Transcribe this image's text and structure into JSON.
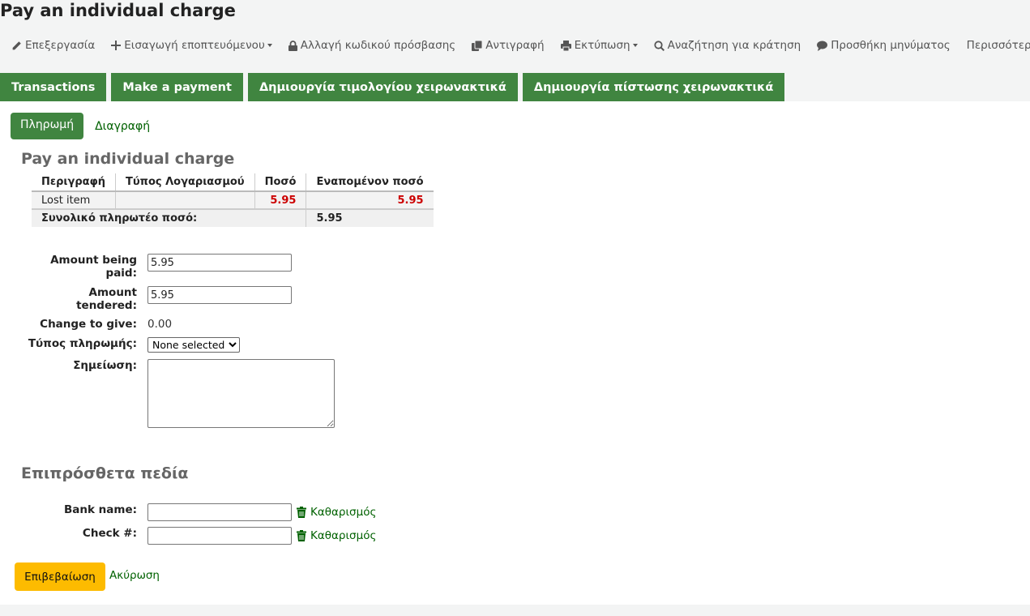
{
  "page_title": "Pay an individual charge",
  "toolbar": {
    "edit": "Επεξεργασία",
    "add_guarantee": "Εισαγωγή εποπτευόμενου",
    "change_password": "Αλλαγή κωδικού πρόσβασης",
    "duplicate": "Αντιγραφή",
    "print": "Εκτύπωση",
    "search_hold": "Αναζήτηση για κράτηση",
    "add_message": "Προσθήκη μηνύματος",
    "more": "Περισσότερα"
  },
  "tabs": [
    "Transactions",
    "Make a payment",
    "Δημιουργία τιμολογίου χειρωνακτικά",
    "Δημιουργία πίστωσης χειρωνακτικά"
  ],
  "subtabs": {
    "pay": "Πληρωμή",
    "delete": "Διαγραφή"
  },
  "section_title": "Pay an individual charge",
  "table": {
    "headers": [
      "Περιγραφή",
      "Τύπος Λογαριασμού",
      "Ποσό",
      "Εναπομένον ποσό"
    ],
    "row": {
      "description": "Lost item",
      "account_type": "",
      "amount": "5.95",
      "outstanding": "5.95"
    },
    "total_label": "Συνολικό πληρωτέο ποσό:",
    "total_value": "5.95"
  },
  "form": {
    "amount_paid_label": "Amount being paid:",
    "amount_paid_value": "5.95",
    "amount_tendered_label": "Amount tendered:",
    "amount_tendered_value": "5.95",
    "change_label": "Change to give:",
    "change_value": "0.00",
    "payment_type_label": "Τύπος πληρωμής:",
    "payment_type_value": "None selected",
    "note_label": "Σημείωση:"
  },
  "extra_fields": {
    "title": "Επιπρόσθετα πεδία",
    "bank_label": "Bank name:",
    "check_label": "Check #:",
    "clear_label": "Καθαρισμός"
  },
  "actions": {
    "confirm": "Επιβεβαίωση",
    "cancel": "Ακύρωση"
  },
  "colors": {
    "green": "#408540",
    "link": "#006100",
    "confirm": "#fdbb00",
    "amount_red": "#cc0000"
  }
}
